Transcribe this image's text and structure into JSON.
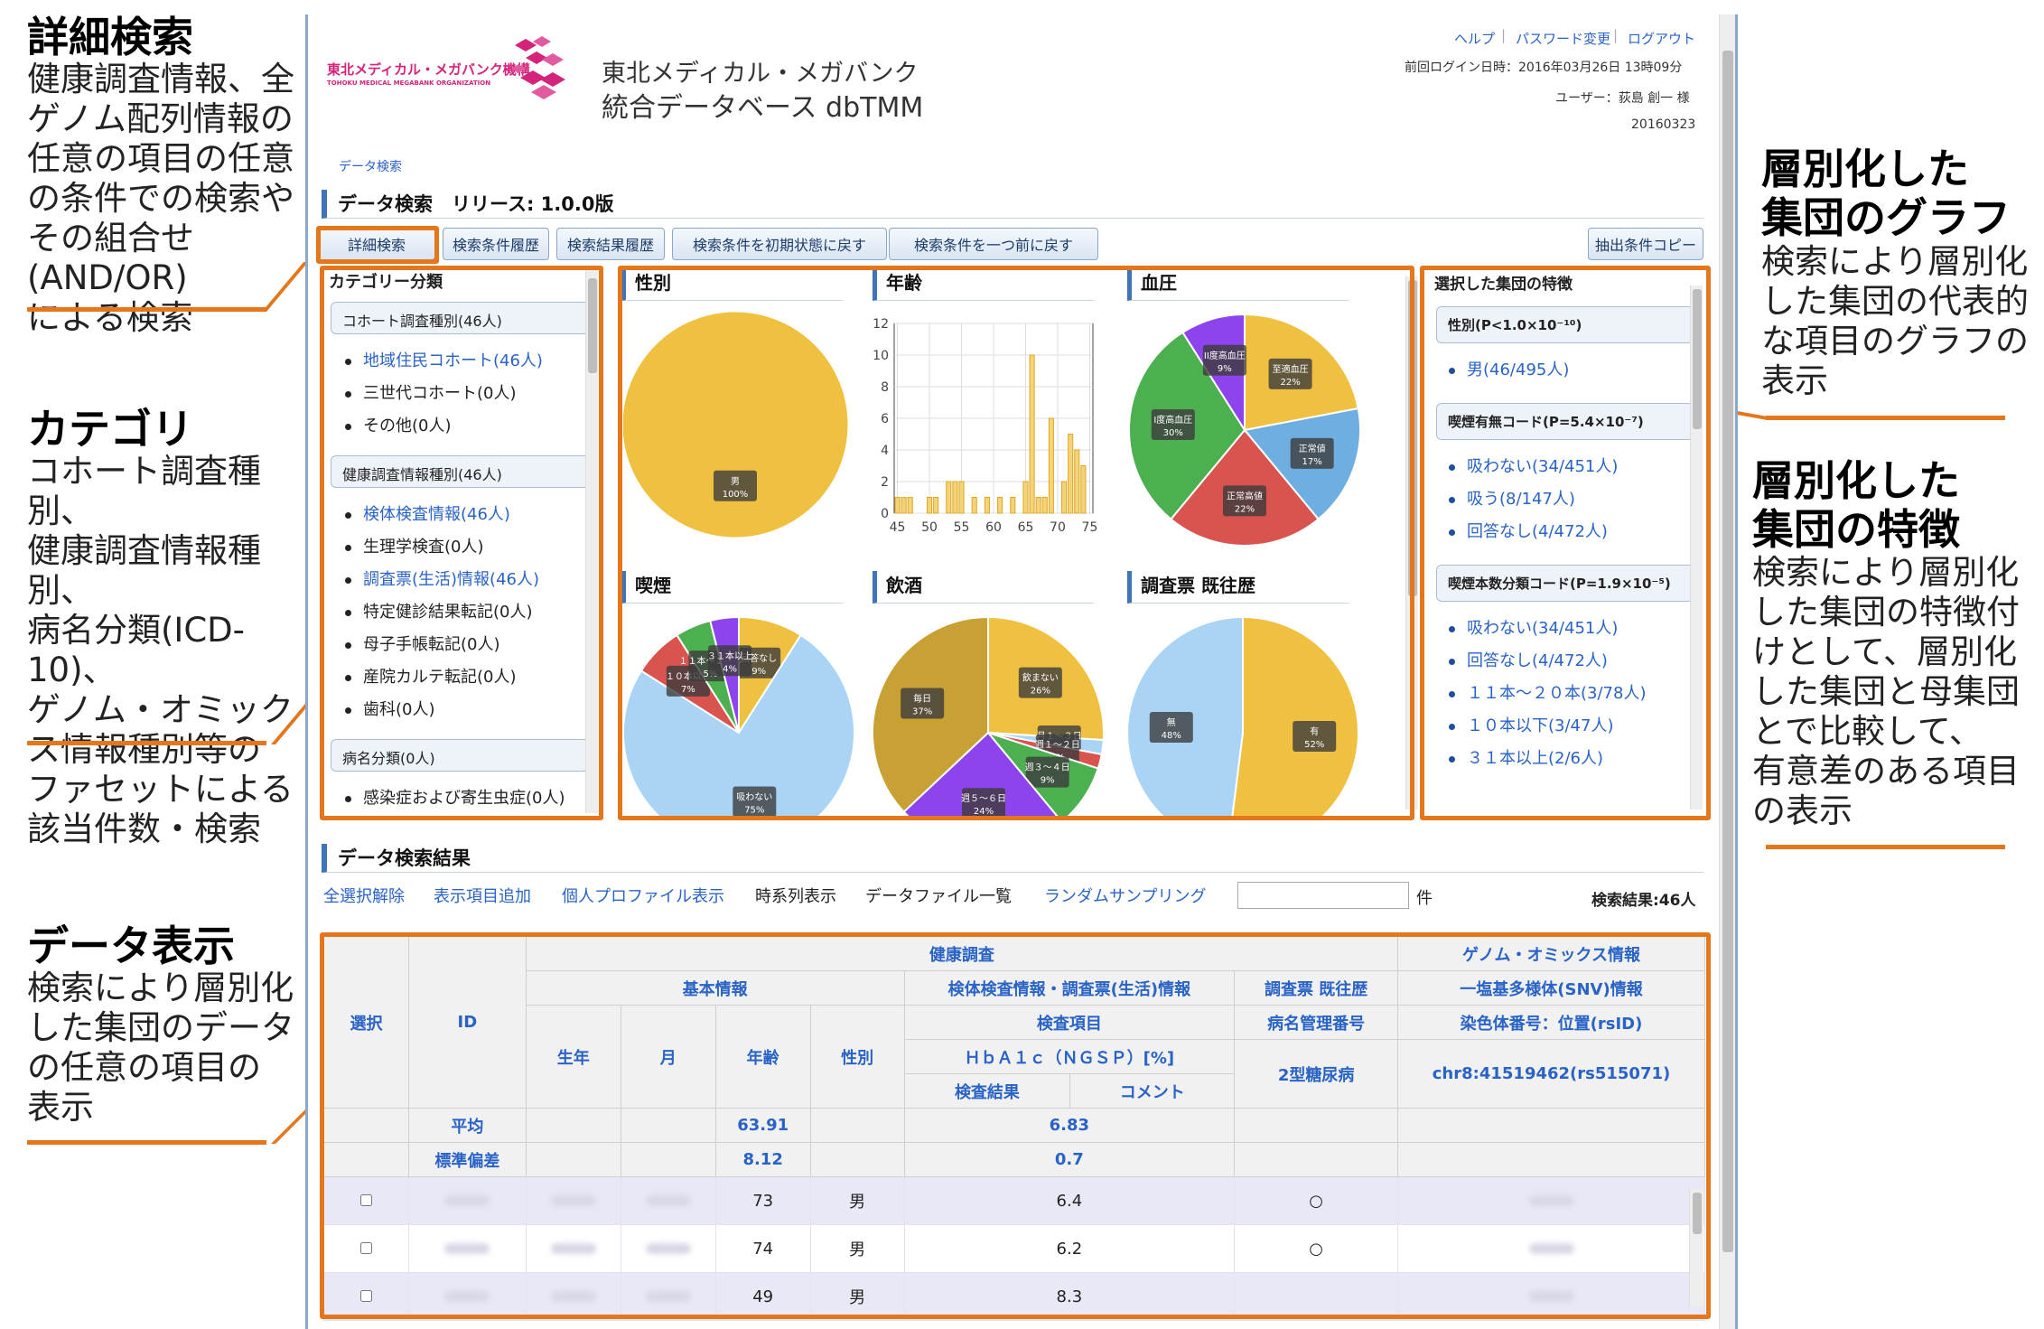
{
  "annotations": {
    "advanced_search": {
      "title": "詳細検索",
      "body": [
        "健康調査情報、全",
        "ゲノム配列情報の",
        "任意の項目の任意",
        "の条件での検索や",
        "その組合せ(AND/OR)",
        "による検索"
      ]
    },
    "category": {
      "title": "カテゴリ",
      "body": [
        "コホート調査種別、",
        "健康調査情報種別、",
        "病名分類(ICD-10)、",
        "ゲノム・オミック",
        "ス情報種別等の",
        "ファセットによる",
        "該当件数・検索"
      ]
    },
    "data_display": {
      "title": "データ表示",
      "body": [
        "検索により層別化",
        "した集団のデータ",
        "の任意の項目の",
        "表示"
      ]
    },
    "graph": {
      "title": [
        "層別化した",
        "集団のグラフ"
      ],
      "body": [
        "検索により層別化",
        "した集団の代表的",
        "な項目のグラフの",
        "表示"
      ]
    },
    "features": {
      "title": [
        "層別化した",
        "集団の特徴"
      ],
      "body": [
        "検索により層別化",
        "した集団の特徴付",
        "けとして、層別化",
        "した集団と母集団",
        "とで比較して、",
        "有意差のある項目",
        "の表示"
      ]
    }
  },
  "header": {
    "logo_small": "東北メディカル・メガバンク機構",
    "logo_sub": "TOHOKU MEDICAL MEGABANK ORGANIZATION",
    "app_title_line1": "東北メディカル・メガバンク",
    "app_title_line2": "統合データベース dbTMM",
    "links": {
      "help": "ヘルプ",
      "password": "パスワード変更",
      "logout": "ログアウト"
    },
    "last_login": "前回ログイン日時：2016年03月26日 13時09分",
    "user": "ユーザー：荻島 創一 様",
    "date": "20160323"
  },
  "breadcrumb": "データ検索",
  "page_title": "データ検索　リリース: 1.0.0版",
  "toolbar": {
    "advanced": "詳細検索",
    "history": "検索条件履歴",
    "result_history": "検索結果履歴",
    "reset": "検索条件を初期状態に戻す",
    "undo": "検索条件を一つ前に戻す",
    "copy": "抽出条件コピー"
  },
  "category": {
    "title": "カテゴリー分類",
    "groups": [
      {
        "header": "コホート調査種別(46人)",
        "items": [
          {
            "label": "地域住民コホート(46人)",
            "link": true
          },
          {
            "label": "三世代コホート(0人)",
            "link": false
          },
          {
            "label": "その他(0人)",
            "link": false
          }
        ]
      },
      {
        "header": "健康調査情報種別(46人)",
        "items": [
          {
            "label": "検体検査情報(46人)",
            "link": true
          },
          {
            "label": "生理学検査(0人)",
            "link": false
          },
          {
            "label": "調査票(生活)情報(46人)",
            "link": true
          },
          {
            "label": "特定健診結果転記(0人)",
            "link": false
          },
          {
            "label": "母子手帳転記(0人)",
            "link": false
          },
          {
            "label": "産院カルテ転記(0人)",
            "link": false
          },
          {
            "label": "歯科(0人)",
            "link": false
          }
        ]
      },
      {
        "header": "病名分類(0人)",
        "items": [
          {
            "label": "感染症および寄生虫症(0人)",
            "link": false
          }
        ]
      }
    ]
  },
  "charts": {
    "sex": {
      "title": "性別"
    },
    "age": {
      "title": "年齢"
    },
    "bp": {
      "title": "血圧"
    },
    "smoking": {
      "title": "喫煙"
    },
    "drinking": {
      "title": "飲酒"
    },
    "history": {
      "title": "調査票 既往歴"
    }
  },
  "chart_data": [
    {
      "type": "pie",
      "title": "性別",
      "slices": [
        {
          "label": "男",
          "value": 100,
          "color": "#f0c040"
        }
      ]
    },
    {
      "type": "bar",
      "title": "年齢",
      "x": [
        45,
        46,
        47,
        48,
        49,
        50,
        51,
        52,
        53,
        54,
        55,
        56,
        57,
        58,
        59,
        60,
        61,
        62,
        63,
        64,
        65,
        66,
        67,
        68,
        69,
        70,
        71,
        72,
        73,
        74,
        75
      ],
      "values": [
        1,
        1,
        1,
        0,
        0,
        1,
        1,
        0,
        2,
        2,
        2,
        0,
        1,
        0,
        1,
        0,
        1,
        0,
        1,
        0,
        2,
        10,
        1,
        1,
        6,
        0,
        2,
        5,
        4,
        3,
        0
      ],
      "ylim": [
        0,
        12
      ],
      "xticks": [
        45,
        50,
        55,
        60,
        65,
        70,
        75
      ],
      "yticks": [
        0,
        2,
        4,
        6,
        8,
        10,
        12
      ],
      "color": "#f5d37a"
    },
    {
      "type": "pie",
      "title": "血圧",
      "slices": [
        {
          "label": "至適血圧",
          "value": 22,
          "color": "#f0c040"
        },
        {
          "label": "正常値",
          "value": 17,
          "color": "#6faee0"
        },
        {
          "label": "正常高値",
          "value": 22,
          "color": "#d9534f"
        },
        {
          "label": "I度高血圧",
          "value": 30,
          "color": "#4caf50"
        },
        {
          "label": "II度高血圧",
          "value": 9,
          "color": "#8e44ec"
        }
      ]
    },
    {
      "type": "pie",
      "title": "喫煙",
      "slices": [
        {
          "label": "回答なし",
          "value": 9,
          "color": "#f0c040"
        },
        {
          "label": "吸わない",
          "value": 75,
          "color": "#a9d4f5"
        },
        {
          "label": "１０本以下",
          "value": 7,
          "color": "#d9534f"
        },
        {
          "label": "１１本〜２０本",
          "value": 5,
          "color": "#4caf50"
        },
        {
          "label": "３１本以上",
          "value": 4,
          "color": "#8e44ec"
        }
      ]
    },
    {
      "type": "pie",
      "title": "飲酒",
      "slices": [
        {
          "label": "飲まない",
          "value": 26,
          "color": "#f0c040"
        },
        {
          "label": "月１〜３日",
          "value": 2,
          "color": "#a9d4f5"
        },
        {
          "label": "週１〜２日",
          "value": 2,
          "color": "#d9534f"
        },
        {
          "label": "週３〜４日",
          "value": 9,
          "color": "#4caf50"
        },
        {
          "label": "週５〜６日",
          "value": 24,
          "color": "#8e44ec"
        },
        {
          "label": "毎日",
          "value": 37,
          "color": "#c9a033"
        }
      ]
    },
    {
      "type": "pie",
      "title": "調査票 既往歴",
      "slices": [
        {
          "label": "有",
          "value": 52,
          "color": "#f0c040"
        },
        {
          "label": "無",
          "value": 48,
          "color": "#a9d4f5"
        }
      ]
    }
  ],
  "features": {
    "title": "選択した集団の特徴",
    "groups": [
      {
        "header": "性別(P<1.0×10⁻¹⁰)",
        "items": [
          "男(46/495人)"
        ]
      },
      {
        "header": "喫煙有無コード(P=5.4×10⁻⁷)",
        "items": [
          "吸わない(34/451人)",
          "吸う(8/147人)",
          "回答なし(4/472人)"
        ]
      },
      {
        "header": "喫煙本数分類コード(P=1.9×10⁻⁵)",
        "items": [
          "吸わない(34/451人)",
          "回答なし(4/472人)",
          "１１本〜２０本(3/78人)",
          "１０本以下(3/47人)",
          "３１本以上(2/6人)"
        ]
      }
    ]
  },
  "results": {
    "title": "データ検索結果",
    "tools": {
      "deselect": "全選択解除",
      "add_items": "表示項目追加",
      "profile": "個人プロファイル表示",
      "timeseries": "時系列表示",
      "files": "データファイル一覧",
      "sampling": "ランダムサンプリング"
    },
    "count_unit": "件",
    "count": "検索結果:46人",
    "table": {
      "h_health": "健康調査",
      "h_genome": "ゲノム・オミックス情報",
      "h_basic": "基本情報",
      "h_lab": "検体検査情報・調査票(生活)情報",
      "h_q": "調査票 既往歴",
      "h_snv": "一塩基多様体(SNV)情報",
      "h_item": "検査項目",
      "h_disease": "病名管理番号",
      "h_chr": "染色体番号：位置(rsID)",
      "h_select": "選択",
      "h_id": "ID",
      "h_birthyear": "生年",
      "h_month": "月",
      "h_age": "年齢",
      "h_sex": "性別",
      "h_hba1c": "ＨｂＡ１ｃ（ＮＧＳＰ）[%]",
      "h_diabetes": "2型糖尿病",
      "h_snp": "chr8:41519462(rs515071)",
      "h_result": "検査結果",
      "h_comment": "コメント",
      "mean_label": "平均",
      "mean_age": "63.91",
      "mean_hba1c": "6.83",
      "sd_label": "標準偏差",
      "sd_age": "8.12",
      "sd_hba1c": "0.7",
      "rows": [
        {
          "age": "73",
          "sex": "男",
          "hba1c": "6.4",
          "dm": "○"
        },
        {
          "age": "74",
          "sex": "男",
          "hba1c": "6.2",
          "dm": "○"
        },
        {
          "age": "49",
          "sex": "男",
          "hba1c": "8.3",
          "dm": ""
        }
      ]
    }
  }
}
